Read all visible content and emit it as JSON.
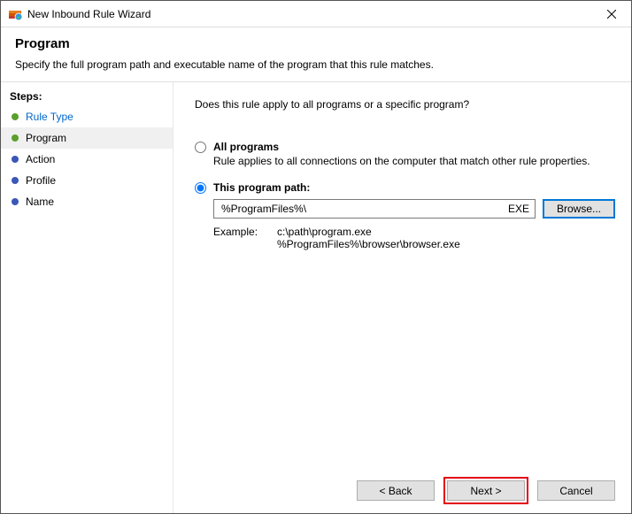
{
  "window": {
    "title": "New Inbound Rule Wizard"
  },
  "header": {
    "heading": "Program",
    "subtitle": "Specify the full program path and executable name of the program that this rule matches."
  },
  "sidebar": {
    "label": "Steps:",
    "items": [
      {
        "label": "Rule Type",
        "state": "done",
        "link": true
      },
      {
        "label": "Program",
        "state": "current",
        "link": false
      },
      {
        "label": "Action",
        "state": "pending",
        "link": false
      },
      {
        "label": "Profile",
        "state": "pending",
        "link": false
      },
      {
        "label": "Name",
        "state": "pending",
        "link": false
      }
    ]
  },
  "main": {
    "question": "Does this rule apply to all programs or a specific program?",
    "option_all": {
      "title": "All programs",
      "desc": "Rule applies to all connections on the computer that match other rule properties."
    },
    "option_path": {
      "title": "This program path:",
      "value": "%ProgramFiles%\\",
      "exe_suffix": "EXE",
      "browse_label": "Browse...",
      "example_label": "Example:",
      "example_text": "c:\\path\\program.exe\n%ProgramFiles%\\browser\\browser.exe"
    }
  },
  "buttons": {
    "back": "< Back",
    "next": "Next >",
    "cancel": "Cancel"
  }
}
